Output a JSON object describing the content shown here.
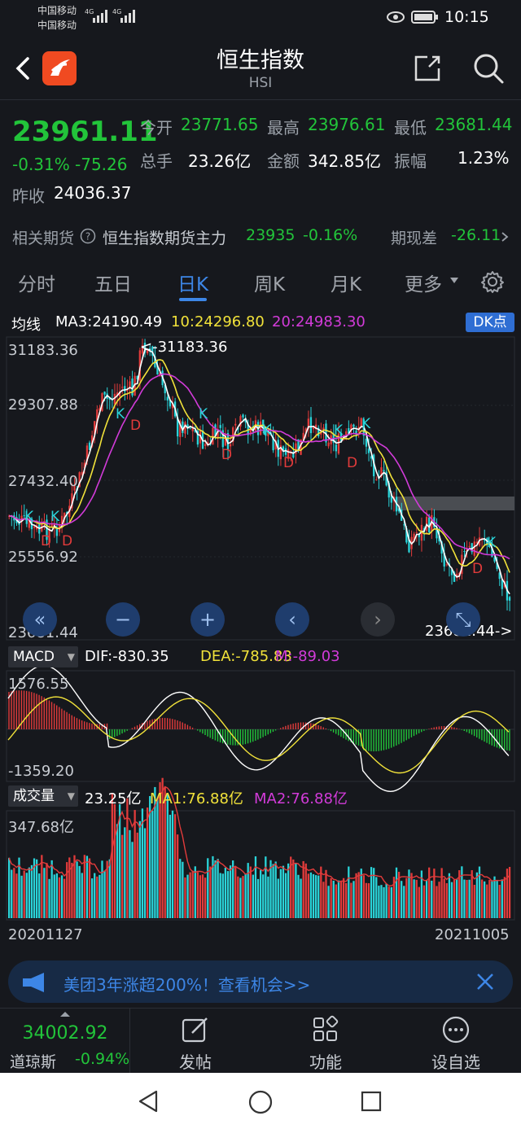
{
  "status_bar": {
    "carrier1": "中国移动",
    "carrier2": "中国移动",
    "net1": "4G",
    "net2": "4G",
    "time": "10:15"
  },
  "header": {
    "title": "恒生指数",
    "subtitle": "HSI",
    "back_icon": "back-arrow-icon",
    "share_icon": "share-icon",
    "search_icon": "search-icon"
  },
  "quote": {
    "price": "23961.11",
    "change_pct": "-0.31%",
    "change_abs": "-75.26",
    "prev_close_label": "昨收",
    "prev_close": "24036.37",
    "open_label": "今开",
    "open": "23771.65",
    "high_label": "最高",
    "high": "23976.61",
    "low_label": "最低",
    "low": "23681.44",
    "volume_label": "总手",
    "volume": "23.26亿",
    "amount_label": "金额",
    "amount": "342.85亿",
    "amplitude_label": "振幅",
    "amplitude": "1.23%"
  },
  "futures": {
    "label": "相关期货",
    "name": "恒生指数期货主力",
    "price": "23935",
    "change": "-0.16%",
    "basis_label": "期现差",
    "basis": "-26.11"
  },
  "tabs": [
    "分时",
    "五日",
    "日K",
    "周K",
    "月K",
    "更多"
  ],
  "active_tab": "日K",
  "ma_legend": {
    "label": "均线",
    "ma3": "MA3:24190.49",
    "ma10": "10:24296.80",
    "ma20": "20:24983.30",
    "dk_button": "DK点"
  },
  "kline": {
    "y_labels": [
      "31183.36",
      "29307.88",
      "27432.40",
      "25556.92",
      "23681.44"
    ],
    "max_marker": "<-31183.36",
    "min_marker": "23681.44->"
  },
  "macd": {
    "label": "MACD",
    "dif": "DIF:-830.35",
    "dea": "DEA:-785.83",
    "m": "M:-89.03",
    "y_top": "1576.55",
    "y_bottom": "-1359.20"
  },
  "volume": {
    "label": "成交量",
    "value": "23.25亿",
    "ma1": "MA1:76.88亿",
    "ma2": "MA2:76.88亿",
    "y_top": "347.68亿",
    "date_start": "20201127",
    "date_end": "20211005"
  },
  "banner": {
    "text": "美团3年涨超200%！查看机会>>"
  },
  "toolbar": {
    "ticker_price": "34002.92",
    "ticker_name": "道琼斯",
    "ticker_change": "-0.94%",
    "post_label": "发帖",
    "func_label": "功能",
    "watch_label": "设自选"
  },
  "colors": {
    "up": "#e23b3b",
    "down": "#22c43a",
    "candle_down": "#2ad4d9",
    "accent": "#3d86e6",
    "ma3": "#ffffff",
    "ma10": "#f1e23a",
    "ma20": "#d23bd9"
  }
}
